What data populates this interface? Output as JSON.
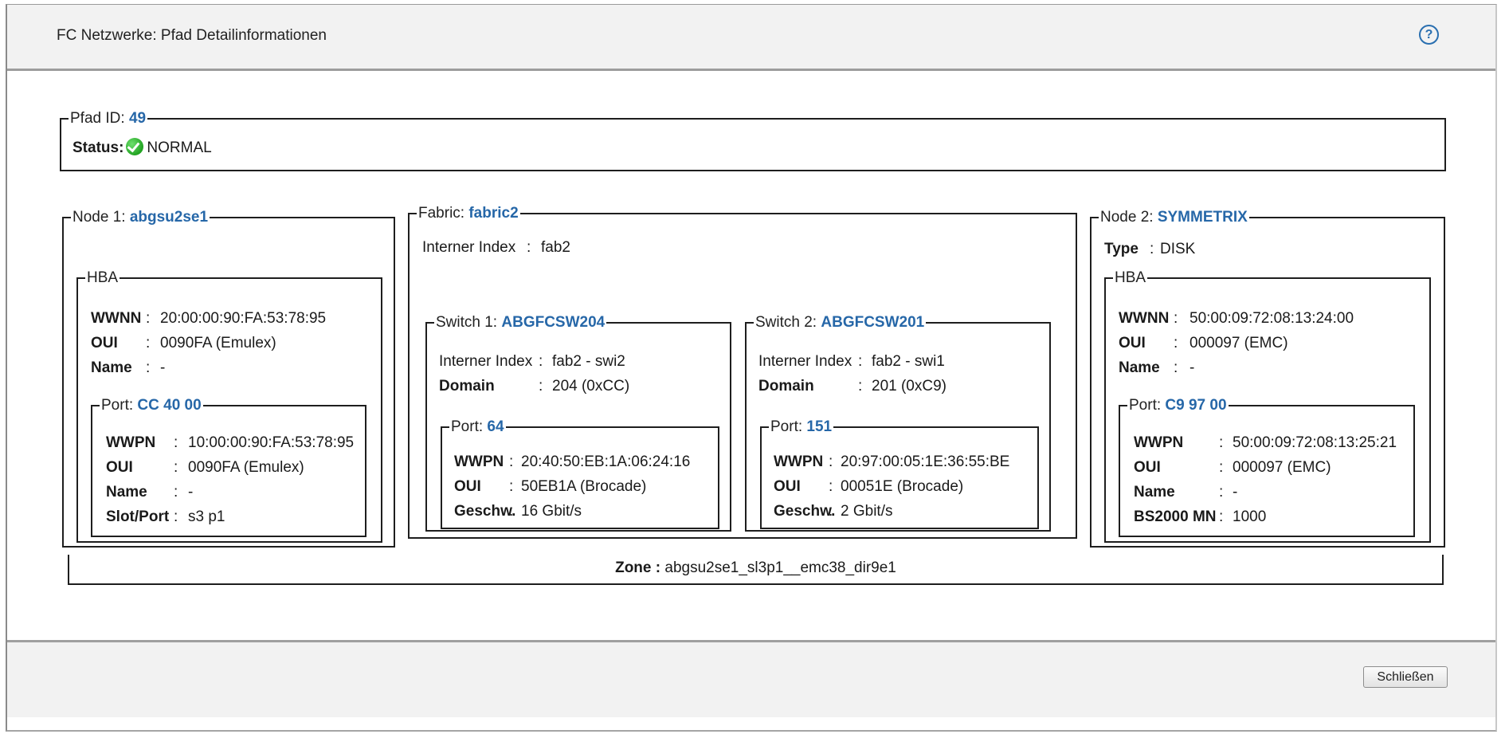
{
  "dialog": {
    "title": "FC Netzwerke: Pfad Detailinformationen",
    "help_glyph": "?",
    "close_label": "Schließen"
  },
  "path": {
    "id_label": "Pfad ID:",
    "id_value": "49",
    "status_label": "Status:",
    "status_value": "NORMAL",
    "status_icon": "check-circle-icon"
  },
  "node1": {
    "legend_label": "Node 1:",
    "name": "abgsu2se1",
    "hba": {
      "legend": "HBA",
      "wwnn_label": "WWNN",
      "wwnn": "20:00:00:90:FA:53:78:95",
      "oui_label": "OUI",
      "oui": "0090FA (Emulex)",
      "name_label": "Name",
      "name": "-"
    },
    "port": {
      "legend_label": "Port:",
      "id": "CC 40 00",
      "wwpn_label": "WWPN",
      "wwpn": "10:00:00:90:FA:53:78:95",
      "oui_label": "OUI",
      "oui": "0090FA (Emulex)",
      "name_label": "Name",
      "name": "-",
      "slot_label": "Slot/Port",
      "slot": "s3 p1"
    }
  },
  "fabric": {
    "legend_label": "Fabric:",
    "name": "fabric2",
    "index_label": "Interner Index",
    "index": "fab2",
    "switch1": {
      "legend_label": "Switch 1:",
      "name": "ABGFCSW204",
      "index_label": "Interner Index",
      "index": "fab2 - swi2",
      "domain_label": "Domain",
      "domain": "204 (0xCC)",
      "port": {
        "legend_label": "Port:",
        "id": "64",
        "wwpn_label": "WWPN",
        "wwpn": "20:40:50:EB:1A:06:24:16",
        "oui_label": "OUI",
        "oui": "50EB1A (Brocade)",
        "speed_label": "Geschw.",
        "speed": "16 Gbit/s"
      }
    },
    "switch2": {
      "legend_label": "Switch 2:",
      "name": "ABGFCSW201",
      "index_label": "Interner Index",
      "index": "fab2 - swi1",
      "domain_label": "Domain",
      "domain": "201 (0xC9)",
      "port": {
        "legend_label": "Port:",
        "id": "151",
        "wwpn_label": "WWPN",
        "wwpn": "20:97:00:05:1E:36:55:BE",
        "oui_label": "OUI",
        "oui": "00051E (Brocade)",
        "speed_label": "Geschw.",
        "speed": "2 Gbit/s"
      }
    }
  },
  "node2": {
    "legend_label": "Node 2:",
    "name": "SYMMETRIX",
    "type_label": "Type",
    "type": "DISK",
    "hba": {
      "legend": "HBA",
      "wwnn_label": "WWNN",
      "wwnn": "50:00:09:72:08:13:24:00",
      "oui_label": "OUI",
      "oui": "000097 (EMC)",
      "name_label": "Name",
      "name": "-"
    },
    "port": {
      "legend_label": "Port:",
      "id": "C9 97 00",
      "wwpn_label": "WWPN",
      "wwpn": "50:00:09:72:08:13:25:21",
      "oui_label": "OUI",
      "oui": "000097 (EMC)",
      "name_label": "Name",
      "name": "-",
      "mn_label": "BS2000 MN",
      "mn": "1000"
    }
  },
  "zone": {
    "label": "Zone :",
    "value": "abgsu2se1_sl3p1__emc38_dir9e1"
  },
  "separator": ":"
}
